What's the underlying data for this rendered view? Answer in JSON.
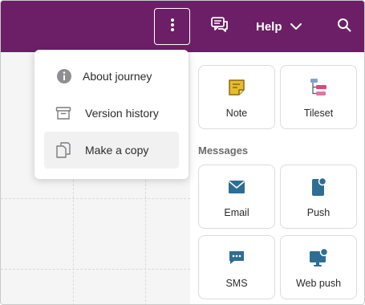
{
  "topbar": {
    "background": "#6c1f66",
    "more_icon": "vertical-ellipsis-icon",
    "comments_icon": "comments-icon",
    "help_label": "Help",
    "help_icon": "chevron-down-icon",
    "search_icon": "search-icon"
  },
  "menu": {
    "items": [
      {
        "label": "About journey",
        "icon": "info-circle-icon"
      },
      {
        "label": "Version history",
        "icon": "archive-box-icon"
      },
      {
        "label": "Make a copy",
        "icon": "copy-icon",
        "highlighted": true
      }
    ]
  },
  "panel": {
    "tools": [
      {
        "label": "Note",
        "icon": "note-icon",
        "color": "#c9a227"
      },
      {
        "label": "Tileset",
        "icon": "tileset-icon",
        "color": "#d6497f"
      }
    ],
    "messages_title": "Messages",
    "messages": [
      {
        "label": "Email",
        "icon": "email-icon",
        "color": "#2f6d94"
      },
      {
        "label": "Push",
        "icon": "push-icon",
        "color": "#2f6d94"
      },
      {
        "label": "SMS",
        "icon": "sms-icon",
        "color": "#2f6d94"
      },
      {
        "label": "Web push",
        "icon": "web-push-icon",
        "color": "#2f6d94"
      }
    ]
  }
}
